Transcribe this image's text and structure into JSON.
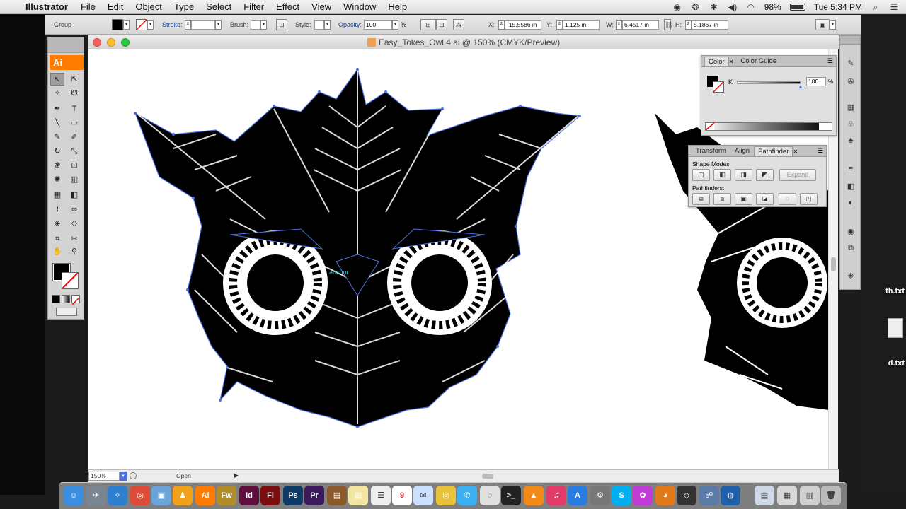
{
  "menubar": {
    "app_name": "Illustrator",
    "menus": [
      "File",
      "Edit",
      "Object",
      "Type",
      "Select",
      "Filter",
      "Effect",
      "View",
      "Window",
      "Help"
    ],
    "battery": "98%",
    "clock": "Tue 5:34 PM"
  },
  "controlbar": {
    "selection_label": "Group",
    "stroke_label": "Stroke:",
    "brush_label": "Brush:",
    "style_label": "Style:",
    "opacity_label": "Opacity:",
    "opacity_value": "100",
    "opacity_unit": "%",
    "x_label": "X:",
    "x_value": "-15.5586 in",
    "y_label": "Y:",
    "y_value": "1.125 in",
    "w_label": "W:",
    "w_value": "6.4517 in",
    "h_label": "H:",
    "h_value": "5.1867 in"
  },
  "document": {
    "title": "Easy_Tokes_Owl 4.ai @ 150% (CMYK/Preview)",
    "zoom": "150%",
    "status": "Open",
    "cursor_label": "anchor"
  },
  "tools": {
    "badge": "Ai",
    "items": [
      "selection",
      "direct-selection",
      "magic-wand",
      "lasso",
      "pen",
      "type",
      "line-segment",
      "rectangle",
      "paintbrush",
      "pencil",
      "rotate",
      "scale",
      "warp",
      "free-transform",
      "symbol-sprayer",
      "column-graph",
      "mesh",
      "gradient",
      "eyedropper",
      "blend",
      "live-paint",
      "live-paint-selection",
      "crop-area",
      "slice",
      "hand",
      "zoom"
    ]
  },
  "color_panel": {
    "tabs": [
      "Color",
      "Color Guide"
    ],
    "channel_label": "K",
    "channel_value": "100",
    "unit": "%"
  },
  "pathfinder_panel": {
    "tabs": [
      "Transform",
      "Align",
      "Pathfinder"
    ],
    "shape_modes_label": "Shape Modes:",
    "expand_label": "Expand",
    "pathfinders_label": "Pathfinders:"
  },
  "desktop": {
    "file1": "th.txt",
    "file2": "d.txt"
  },
  "dock": {
    "apps": [
      "Finder",
      "Launchpad",
      "Safari",
      "Chrome",
      "Preview",
      "VLC",
      "Illustrator",
      "Fireworks",
      "InDesign",
      "Flash",
      "Photoshop",
      "Premiere",
      "Notes",
      "Contacts",
      "Calendar",
      "Photos",
      "Chrome Canary",
      "Messages",
      "Terminal",
      "VLC Player",
      "iTunes",
      "App Store",
      "System Preferences",
      "Skype",
      "Flower",
      "Blender",
      "Unity",
      "Network",
      "Browser",
      "Documents",
      "Downloads",
      "Trash"
    ]
  },
  "colors": {
    "accent_ai": "#ff7c00",
    "anchor_blue": "#4a6fe0",
    "artwork": "#000000"
  }
}
